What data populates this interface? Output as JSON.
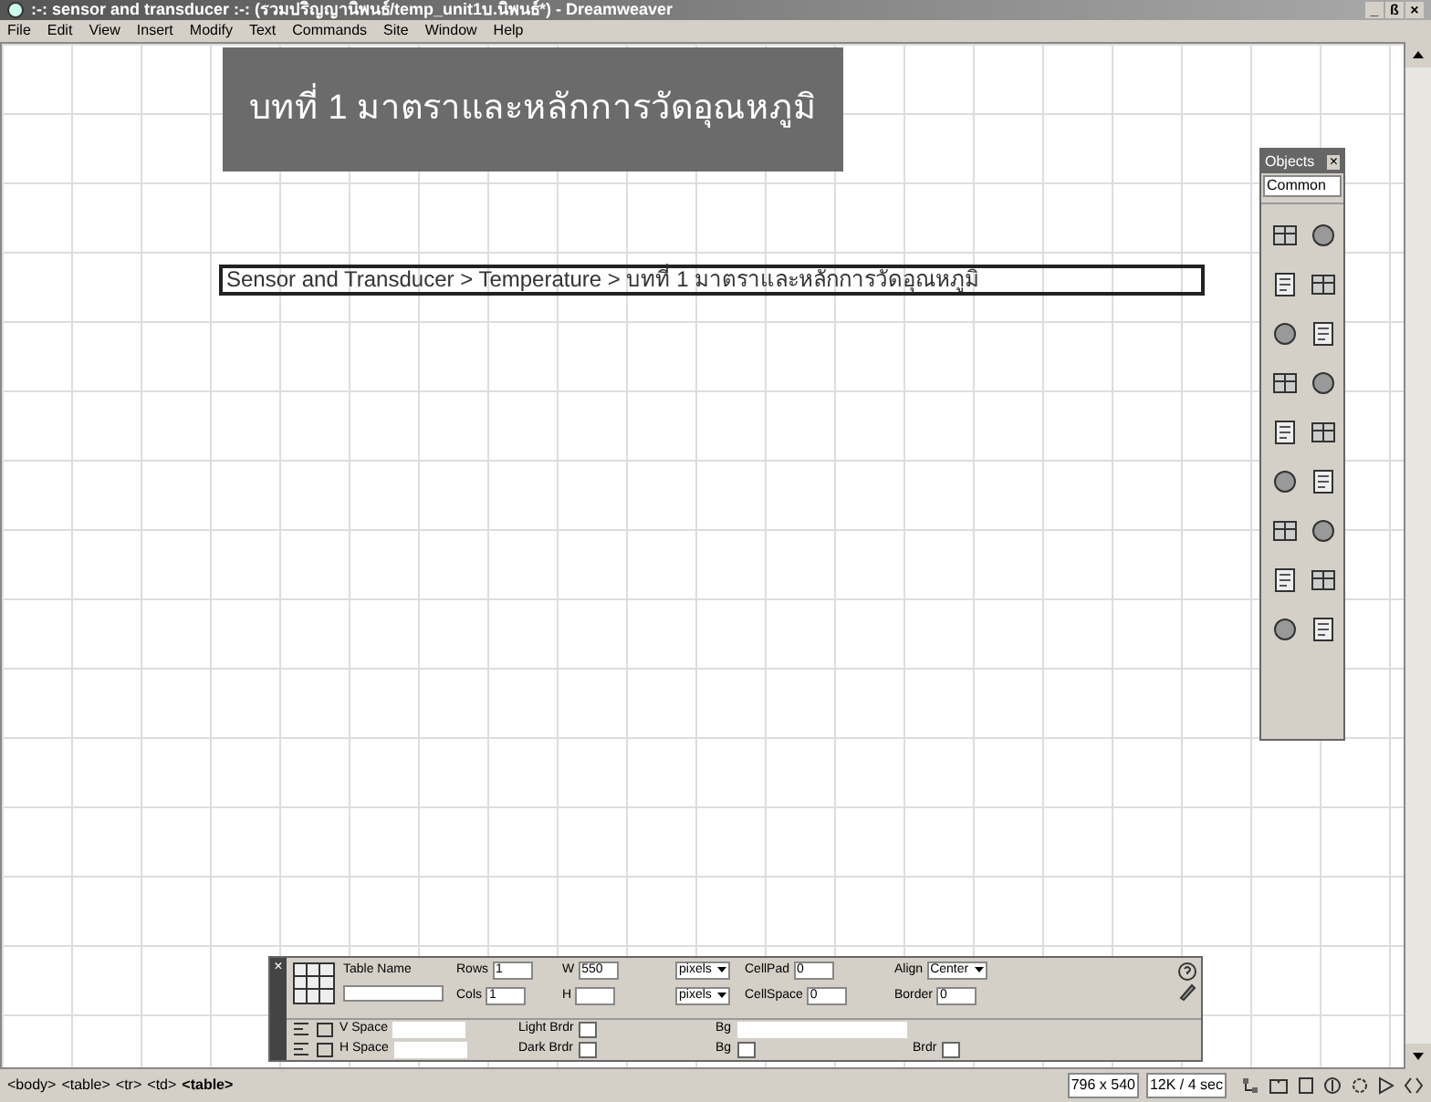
{
  "window": {
    "title": ":-: sensor and transducer :-: (รวมปริญญานิพนธ์/temp_unit1บ.นิพนธ์*) - Dreamweaver",
    "controls": [
      "_",
      "ß",
      "×"
    ]
  },
  "menu": [
    "File",
    "Edit",
    "View",
    "Insert",
    "Modify",
    "Text",
    "Commands",
    "Site",
    "Window",
    "Help"
  ],
  "document": {
    "banner": "บทที่ 1 มาตราและหลักการวัดอุณหภูมิ",
    "breadcrumb": "Sensor and Transducer > Temperature > บทที่ 1 มาตราและหลักการวัดอุณหภูมิ"
  },
  "objects_panel": {
    "title": "Objects",
    "close": "×",
    "category": "Common"
  },
  "property_inspector": {
    "close": "×",
    "table_name": "Table Name",
    "fields": [
      {
        "label": "Rows",
        "value": "1",
        "kind": "input"
      },
      {
        "label": "W",
        "value": "550",
        "kind": "input"
      },
      {
        "value": "pixels",
        "kind": "select"
      },
      {
        "label": "CellPad",
        "value": "0",
        "kind": "input"
      },
      {
        "label": "Align",
        "value": "Center",
        "kind": "select"
      },
      {
        "label": "Cols",
        "value": "1",
        "kind": "input"
      },
      {
        "label": "H",
        "kind": "input"
      },
      {
        "value": "pixels",
        "kind": "select"
      },
      {
        "label": "CellSpace",
        "value": "0",
        "kind": "input"
      },
      {
        "label": "Border",
        "value": "0",
        "kind": "input"
      }
    ],
    "row2": [
      {
        "label": "V Space",
        "kind": "input"
      },
      {
        "label": "Light Brdr",
        "kind": "color"
      },
      {
        "label": "Bg",
        "kind": "wide"
      }
    ],
    "row3": [
      {
        "label": "H Space",
        "kind": "input"
      },
      {
        "label": "Dark Brdr",
        "kind": "color"
      },
      {
        "label": "Bg",
        "kind": "color"
      },
      {
        "label": "Brdr",
        "kind": "color"
      }
    ]
  },
  "status_bar": {
    "tags": [
      "<body>",
      "<table>",
      "<tr>",
      "<td>",
      "<table>"
    ],
    "size": "796 x 540",
    "download": "12K / 4 sec"
  }
}
